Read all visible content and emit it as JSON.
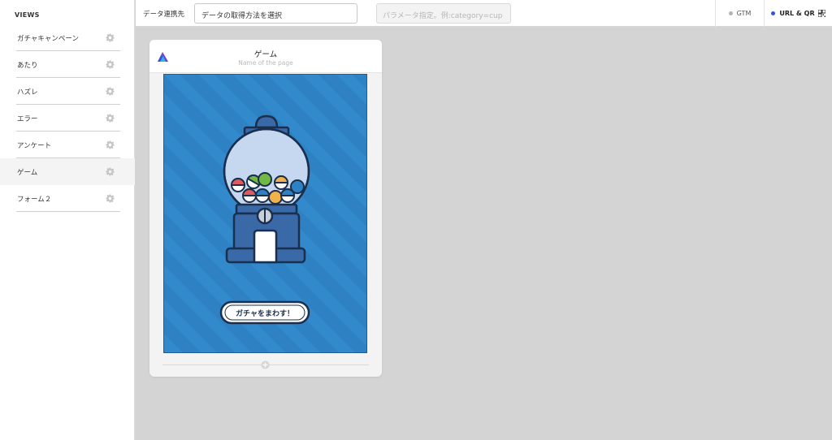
{
  "sidebar": {
    "heading": "VIEWS",
    "items": [
      {
        "label": "ガチャキャンペーン",
        "icon": "gear-icon"
      },
      {
        "label": "あたり",
        "icon": "gear-icon"
      },
      {
        "label": "ハズレ",
        "icon": "gear-icon"
      },
      {
        "label": "エラー",
        "icon": "gear-icon"
      },
      {
        "label": "アンケート",
        "icon": "gear-icon"
      },
      {
        "label": "ゲーム",
        "icon": "gear-icon",
        "active": true
      },
      {
        "label": "フォーム２",
        "icon": "gear-icon"
      }
    ]
  },
  "topbar": {
    "data_link_label": "データ連携先",
    "data_select_value": "データの取得方法を選択",
    "param_placeholder": "パラメータ指定。例:category=cup",
    "gtm_label": "GTM",
    "url_label": "URL & QR",
    "gtm_status_color": "#b4b4b4",
    "url_status_color": "#3b4fd8"
  },
  "page_card": {
    "title": "ゲーム",
    "subtitle": "Name of the page",
    "game": {
      "button_label": "ガチャをまわす！",
      "background_color": "#2e82c4",
      "machine_color": "#3a69a8"
    }
  }
}
